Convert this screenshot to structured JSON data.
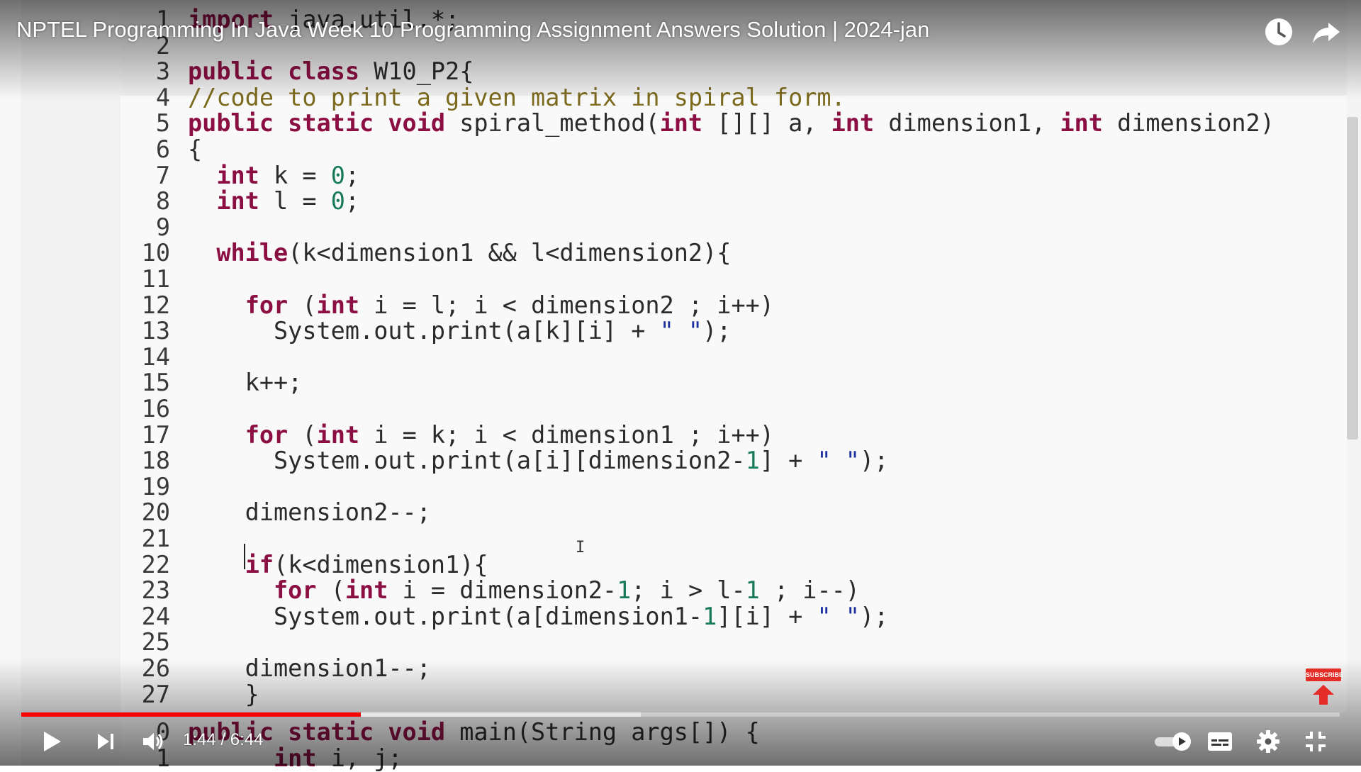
{
  "video": {
    "title": "NPTEL Programming In Java Week 10 Programming Assignment Answers Solution | 2024-jan",
    "time_display": "1:44 / 6:44",
    "played_fraction": 0.2574,
    "buffered_fraction": 0.47,
    "subscribe_badge": "SUBSCRIBE"
  },
  "icons": {
    "watch_later": "clock-icon",
    "share": "share-arrow-icon",
    "play": "play-icon",
    "next": "skip-next-icon",
    "volume": "volume-icon",
    "autoplay": "autoplay-toggle-icon",
    "captions": "captions-icon",
    "settings": "gear-icon",
    "exit_fullscreen": "exit-fullscreen-icon",
    "subscribe": "subscribe-arrow-icon"
  },
  "colors": {
    "progress_played": "#ff0000",
    "keyword": "#8b0f43",
    "number": "#177a5a",
    "string": "#1b2fa0",
    "comment": "#7c6a1e"
  },
  "code_lines": [
    {
      "n": "1",
      "html": "<span class=\"kw\">import</span> java.util.*;"
    },
    {
      "n": "2",
      "html": ""
    },
    {
      "n": "3",
      "html": "<span class=\"kw\">public class</span> W10_P2{"
    },
    {
      "n": "4",
      "html": "<span class=\"cm\">//code to print a given matrix in spiral form.</span>"
    },
    {
      "n": "5",
      "html": "<span class=\"kw\">public static void</span> spiral_method(<span class=\"kw\">int</span> [][] a, <span class=\"kw\">int</span> dimension1, <span class=\"kw\">int</span> dimension2)"
    },
    {
      "n": "6",
      "html": "{"
    },
    {
      "n": "7",
      "html": "  <span class=\"kw\">int</span> k = <span class=\"num\">0</span>;"
    },
    {
      "n": "8",
      "html": "  <span class=\"kw\">int</span> l = <span class=\"num\">0</span>;"
    },
    {
      "n": "9",
      "html": ""
    },
    {
      "n": "10",
      "html": "  <span class=\"kw\">while</span>(k&lt;dimension1 &amp;&amp; l&lt;dimension2){"
    },
    {
      "n": "11",
      "html": ""
    },
    {
      "n": "12",
      "html": "    <span class=\"kw\">for</span> (<span class=\"kw\">int</span> i = l; i &lt; dimension2 ; i++)"
    },
    {
      "n": "13",
      "html": "      System.out.print(a[k][i] + <span class=\"str\">\" \"</span>);"
    },
    {
      "n": "14",
      "html": ""
    },
    {
      "n": "15",
      "html": "    k++;"
    },
    {
      "n": "16",
      "html": ""
    },
    {
      "n": "17",
      "html": "    <span class=\"kw\">for</span> (<span class=\"kw\">int</span> i = k; i &lt; dimension1 ; i++)"
    },
    {
      "n": "18",
      "html": "      System.out.print(a[i][dimension2-<span class=\"num\">1</span>] + <span class=\"str\">\" \"</span>);"
    },
    {
      "n": "19",
      "html": ""
    },
    {
      "n": "20",
      "html": "    dimension2--;"
    },
    {
      "n": "21",
      "html": ""
    },
    {
      "n": "22",
      "html": "    <span class=\"kw\">if</span>(k&lt;dimension1){"
    },
    {
      "n": "23",
      "html": "      <span class=\"kw\">for</span> (<span class=\"kw\">int</span> i = dimension2-<span class=\"num\">1</span>; i &gt; l-<span class=\"num\">1</span> ; i--)"
    },
    {
      "n": "24",
      "html": "      System.out.print(a[dimension1-<span class=\"num\">1</span>][i] + <span class=\"str\">\" \"</span>);"
    },
    {
      "n": "25",
      "html": ""
    },
    {
      "n": "26",
      "html": "    dimension1--;"
    },
    {
      "n": "27",
      "html": "    }"
    },
    {
      "n": "0",
      "html": "<span class=\"kw\">public static void</span> main(String args[]) {"
    },
    {
      "n": "1",
      "html": "      <span class=\"kw\">int</span> i, j;"
    }
  ]
}
